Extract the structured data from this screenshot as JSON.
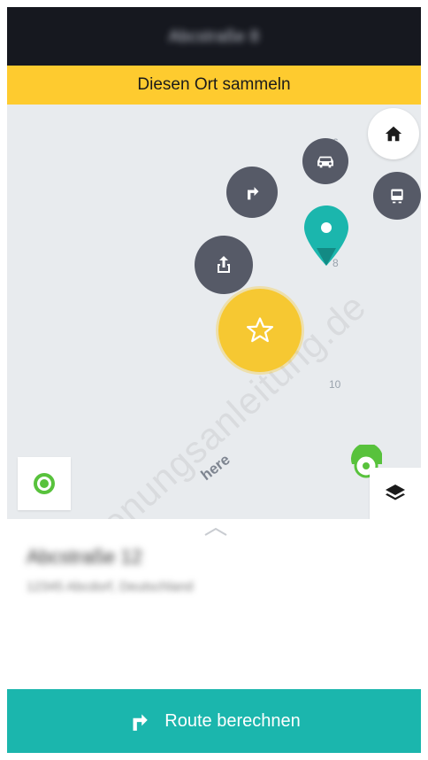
{
  "header": {
    "title": "Abcstraße 8"
  },
  "banner": {
    "label": "Diesen Ort sammeln"
  },
  "map": {
    "labels": [
      "6",
      "8",
      "10"
    ],
    "logo": "here",
    "watermark": "Bedienungsanleitung.de",
    "actions": {
      "home_icon": "home-icon",
      "car_icon": "car-icon",
      "transit_icon": "transit-icon",
      "directions_icon": "directions-icon",
      "share_icon": "share-icon",
      "star_icon": "star-icon",
      "location_icon": "my-location-icon",
      "layers_icon": "layers-icon"
    },
    "colors": {
      "pin": "#1bb6ad",
      "star": "#f6c832",
      "action": "#565a67"
    }
  },
  "place": {
    "name": "Abcstraße 12",
    "address": "12345 Abcdorf, Deutschland"
  },
  "route_button": {
    "label": "Route berechnen",
    "color": "#1bb6ad"
  }
}
